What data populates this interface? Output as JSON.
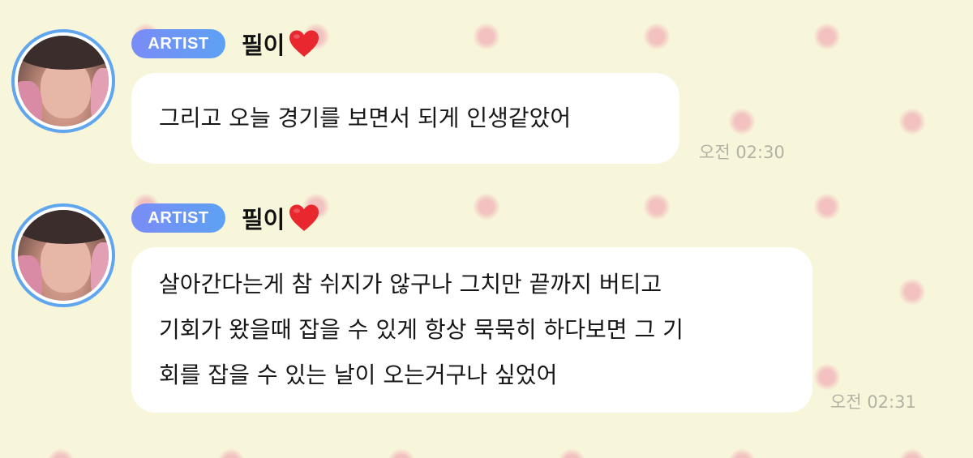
{
  "messages": [
    {
      "badge": "ARTIST",
      "sender": "필이",
      "heart": "red-heart-icon",
      "lines": [
        "그리고 오늘 경기를 보면서 되게 인생같았어"
      ],
      "time": "오전 02:30"
    },
    {
      "badge": "ARTIST",
      "sender": "필이",
      "heart": "red-heart-icon",
      "lines": [
        "살아간다는게 참 쉬지가 않구나 그치만 끝까지 버티고",
        "기회가 왔을때 잡을 수 있게 항상 묵묵히 하다보면 그 기",
        "회를 잡을 수 있는 날이 오는거구나 싶었어"
      ],
      "time": "오전 02:31"
    }
  ],
  "colors": {
    "background": "#f8f6da",
    "dots": "#f2c3c1",
    "bubble": "#ffffff",
    "badge_start": "#7a8cf6",
    "badge_end": "#5da1f4",
    "avatar_ring": "#60a6ef",
    "heart": "#e8272f",
    "time_text": "#b3b1a4"
  }
}
